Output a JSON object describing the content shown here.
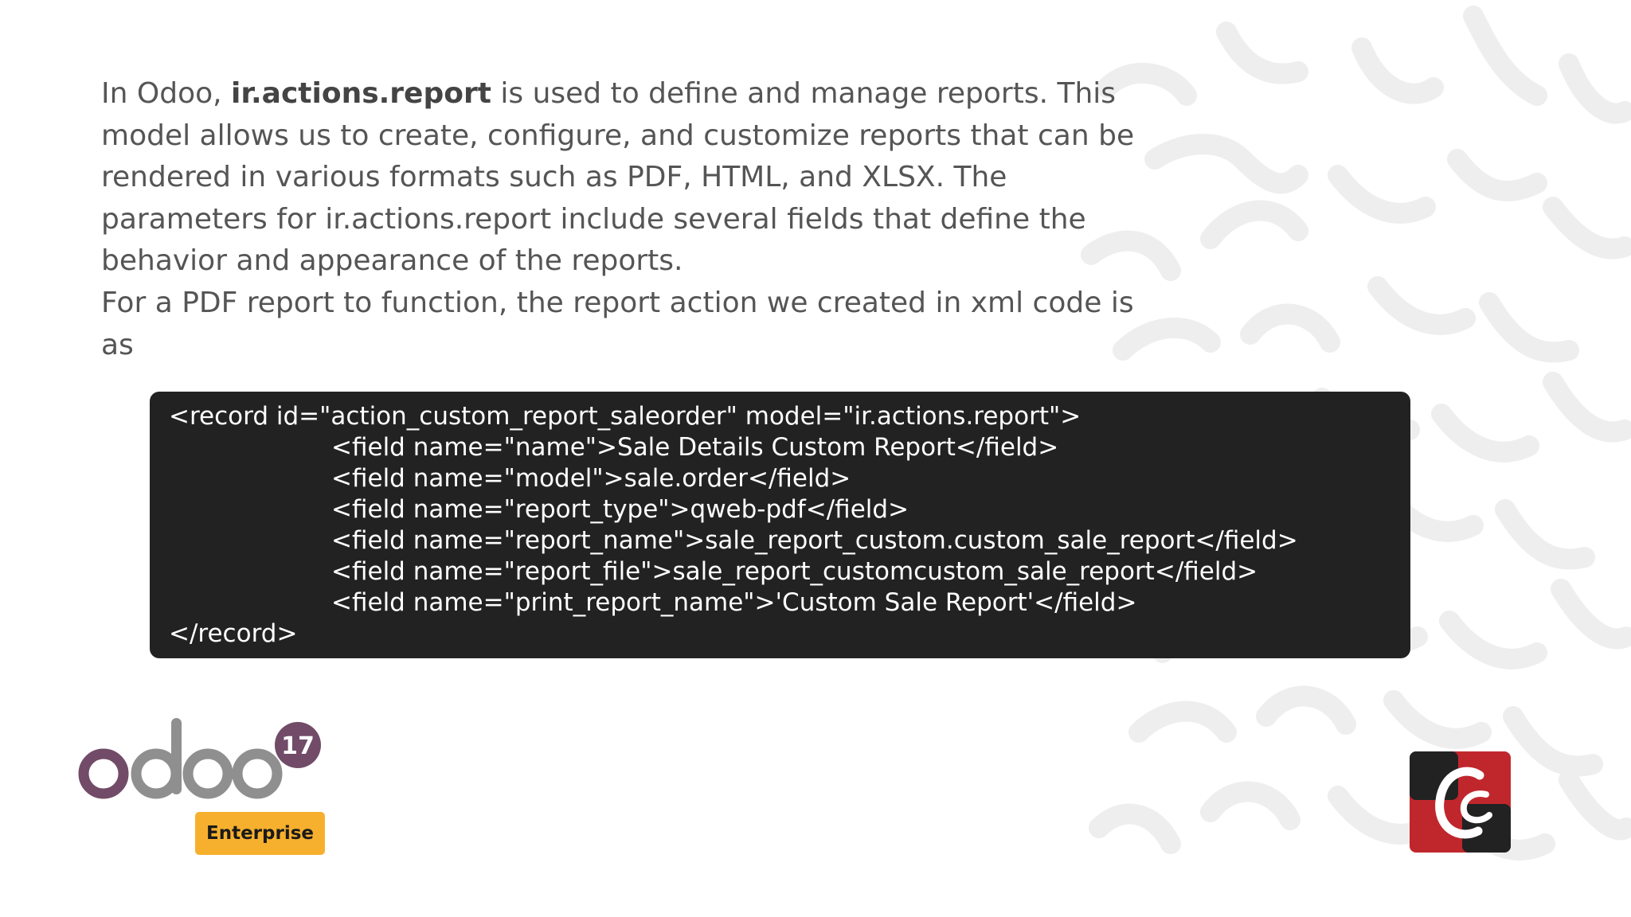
{
  "intro": {
    "part1": "In Odoo, ",
    "bold_term": "ir.actions.report",
    "part2": " is used to define and manage reports. This model allows us to create, configure, and customize reports that can be rendered in various formats such as PDF, HTML, and XLSX. The parameters for ir.actions.report include several fields that define the behavior and appearance of the reports.",
    "part3": "For a PDF report to function, the report action we created in xml code is as"
  },
  "code": {
    "lines": [
      "<record id=\"action_custom_report_saleorder\" model=\"ir.actions.report\">",
      "<field name=\"name\">Sale Details Custom Report</field>",
      "<field name=\"model\">sale.order</field>",
      "<field name=\"report_type\">qweb-pdf</field>",
      "<field name=\"report_name\">sale_report_custom.custom_sale_report</field>",
      "<field name=\"report_file\">sale_report_customcustom_sale_report</field>",
      "<field name=\"print_report_name\">'Custom Sale Report'</field>",
      "</record>"
    ]
  },
  "branding": {
    "odoo_wordmark": "odoo",
    "version_badge": "17",
    "edition_label": "Enterprise",
    "odoo_purple": "#714b67",
    "odoo_gray": "#8f8f8f",
    "enterprise_color": "#f7b02e",
    "code_bg": "#222222",
    "partner_logo_red": "#c0272d",
    "partner_logo_dark": "#222222",
    "partner_logo_icon": "cybrosys-logo"
  }
}
